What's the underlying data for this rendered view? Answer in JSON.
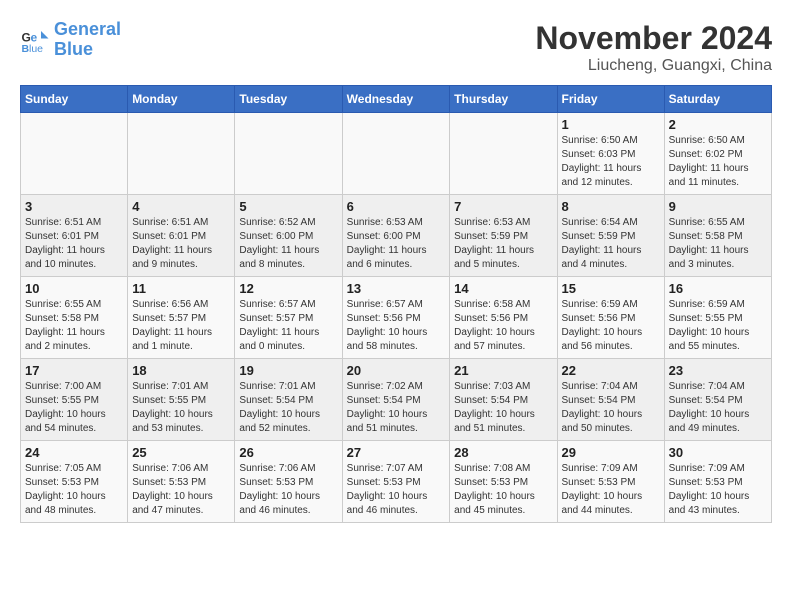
{
  "header": {
    "logo_line1": "General",
    "logo_line2": "Blue",
    "month_title": "November 2024",
    "location": "Liucheng, Guangxi, China"
  },
  "weekdays": [
    "Sunday",
    "Monday",
    "Tuesday",
    "Wednesday",
    "Thursday",
    "Friday",
    "Saturday"
  ],
  "weeks": [
    [
      {
        "day": "",
        "info": ""
      },
      {
        "day": "",
        "info": ""
      },
      {
        "day": "",
        "info": ""
      },
      {
        "day": "",
        "info": ""
      },
      {
        "day": "",
        "info": ""
      },
      {
        "day": "1",
        "info": "Sunrise: 6:50 AM\nSunset: 6:03 PM\nDaylight: 11 hours\nand 12 minutes."
      },
      {
        "day": "2",
        "info": "Sunrise: 6:50 AM\nSunset: 6:02 PM\nDaylight: 11 hours\nand 11 minutes."
      }
    ],
    [
      {
        "day": "3",
        "info": "Sunrise: 6:51 AM\nSunset: 6:01 PM\nDaylight: 11 hours\nand 10 minutes."
      },
      {
        "day": "4",
        "info": "Sunrise: 6:51 AM\nSunset: 6:01 PM\nDaylight: 11 hours\nand 9 minutes."
      },
      {
        "day": "5",
        "info": "Sunrise: 6:52 AM\nSunset: 6:00 PM\nDaylight: 11 hours\nand 8 minutes."
      },
      {
        "day": "6",
        "info": "Sunrise: 6:53 AM\nSunset: 6:00 PM\nDaylight: 11 hours\nand 6 minutes."
      },
      {
        "day": "7",
        "info": "Sunrise: 6:53 AM\nSunset: 5:59 PM\nDaylight: 11 hours\nand 5 minutes."
      },
      {
        "day": "8",
        "info": "Sunrise: 6:54 AM\nSunset: 5:59 PM\nDaylight: 11 hours\nand 4 minutes."
      },
      {
        "day": "9",
        "info": "Sunrise: 6:55 AM\nSunset: 5:58 PM\nDaylight: 11 hours\nand 3 minutes."
      }
    ],
    [
      {
        "day": "10",
        "info": "Sunrise: 6:55 AM\nSunset: 5:58 PM\nDaylight: 11 hours\nand 2 minutes."
      },
      {
        "day": "11",
        "info": "Sunrise: 6:56 AM\nSunset: 5:57 PM\nDaylight: 11 hours\nand 1 minute."
      },
      {
        "day": "12",
        "info": "Sunrise: 6:57 AM\nSunset: 5:57 PM\nDaylight: 11 hours\nand 0 minutes."
      },
      {
        "day": "13",
        "info": "Sunrise: 6:57 AM\nSunset: 5:56 PM\nDaylight: 10 hours\nand 58 minutes."
      },
      {
        "day": "14",
        "info": "Sunrise: 6:58 AM\nSunset: 5:56 PM\nDaylight: 10 hours\nand 57 minutes."
      },
      {
        "day": "15",
        "info": "Sunrise: 6:59 AM\nSunset: 5:56 PM\nDaylight: 10 hours\nand 56 minutes."
      },
      {
        "day": "16",
        "info": "Sunrise: 6:59 AM\nSunset: 5:55 PM\nDaylight: 10 hours\nand 55 minutes."
      }
    ],
    [
      {
        "day": "17",
        "info": "Sunrise: 7:00 AM\nSunset: 5:55 PM\nDaylight: 10 hours\nand 54 minutes."
      },
      {
        "day": "18",
        "info": "Sunrise: 7:01 AM\nSunset: 5:55 PM\nDaylight: 10 hours\nand 53 minutes."
      },
      {
        "day": "19",
        "info": "Sunrise: 7:01 AM\nSunset: 5:54 PM\nDaylight: 10 hours\nand 52 minutes."
      },
      {
        "day": "20",
        "info": "Sunrise: 7:02 AM\nSunset: 5:54 PM\nDaylight: 10 hours\nand 51 minutes."
      },
      {
        "day": "21",
        "info": "Sunrise: 7:03 AM\nSunset: 5:54 PM\nDaylight: 10 hours\nand 51 minutes."
      },
      {
        "day": "22",
        "info": "Sunrise: 7:04 AM\nSunset: 5:54 PM\nDaylight: 10 hours\nand 50 minutes."
      },
      {
        "day": "23",
        "info": "Sunrise: 7:04 AM\nSunset: 5:54 PM\nDaylight: 10 hours\nand 49 minutes."
      }
    ],
    [
      {
        "day": "24",
        "info": "Sunrise: 7:05 AM\nSunset: 5:53 PM\nDaylight: 10 hours\nand 48 minutes."
      },
      {
        "day": "25",
        "info": "Sunrise: 7:06 AM\nSunset: 5:53 PM\nDaylight: 10 hours\nand 47 minutes."
      },
      {
        "day": "26",
        "info": "Sunrise: 7:06 AM\nSunset: 5:53 PM\nDaylight: 10 hours\nand 46 minutes."
      },
      {
        "day": "27",
        "info": "Sunrise: 7:07 AM\nSunset: 5:53 PM\nDaylight: 10 hours\nand 46 minutes."
      },
      {
        "day": "28",
        "info": "Sunrise: 7:08 AM\nSunset: 5:53 PM\nDaylight: 10 hours\nand 45 minutes."
      },
      {
        "day": "29",
        "info": "Sunrise: 7:09 AM\nSunset: 5:53 PM\nDaylight: 10 hours\nand 44 minutes."
      },
      {
        "day": "30",
        "info": "Sunrise: 7:09 AM\nSunset: 5:53 PM\nDaylight: 10 hours\nand 43 minutes."
      }
    ]
  ]
}
